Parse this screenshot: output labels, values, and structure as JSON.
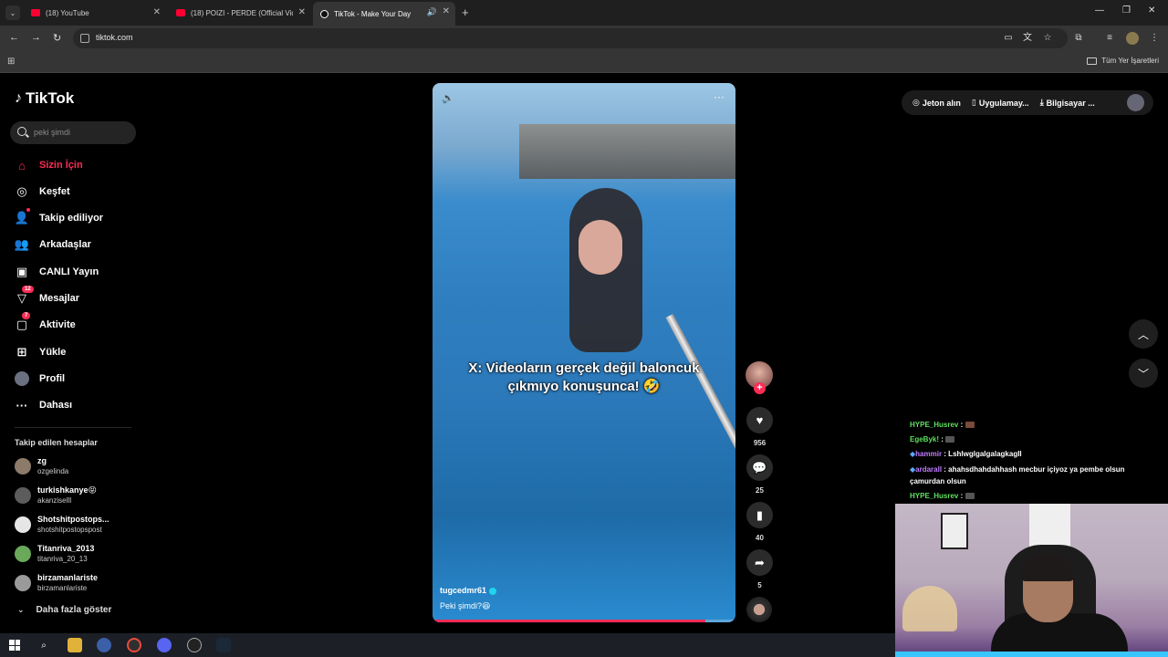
{
  "browser": {
    "tabs": [
      {
        "title": "(18) YouTube"
      },
      {
        "title": "(18) POIZI - PERDE (Official Vid"
      },
      {
        "title": "TikTok - Make Your Day"
      }
    ],
    "url": "tiktok.com",
    "bookmarks_label": "Tüm Yer İşaretleri"
  },
  "sidebar": {
    "logo": "TikTok",
    "search_placeholder": "peki şimdi",
    "nav": [
      {
        "label": "Sizin İçin",
        "icon": "home-icon"
      },
      {
        "label": "Keşfet",
        "icon": "compass-icon"
      },
      {
        "label": "Takip ediliyor",
        "icon": "following-icon"
      },
      {
        "label": "Arkadaşlar",
        "icon": "friends-icon"
      },
      {
        "label": "CANLI Yayın",
        "icon": "live-icon"
      },
      {
        "label": "Mesajlar",
        "icon": "messages-icon",
        "badge": "12"
      },
      {
        "label": "Aktivite",
        "icon": "activity-icon",
        "badge": "7"
      },
      {
        "label": "Yükle",
        "icon": "upload-icon"
      },
      {
        "label": "Profil",
        "icon": "profile-icon"
      },
      {
        "label": "Dahası",
        "icon": "more-icon"
      }
    ],
    "following_title": "Takip edilen hesaplar",
    "following": [
      {
        "name": "zg",
        "username": "ozgelinda"
      },
      {
        "name": "turkishkanye😝",
        "username": "akanzisellI"
      },
      {
        "name": "Shotshitpostops...",
        "username": "shotshitpostopspost"
      },
      {
        "name": "Titanriva_2013",
        "username": "titanriva_20_13"
      },
      {
        "name": "birzamanlariste",
        "username": "birzamanlariste"
      }
    ],
    "show_more": "Daha fazla göster"
  },
  "video": {
    "caption_line1": "X: Videoların gerçek değil baloncuk",
    "caption_line2": "çıkmıyo konuşunca! 🤣",
    "author": "tugcedmr61",
    "description": "Peki şimdi?😆",
    "progress": 0.9
  },
  "actions": {
    "likes": "956",
    "comments": "25",
    "saves": "40",
    "shares": "5"
  },
  "topbar": {
    "coins": "Jeton alın",
    "app": "Uygulamay...",
    "desktop": "Bilgisayar ..."
  },
  "chat": [
    {
      "user": "HYPE_Husrev",
      "text": ":",
      "color": "green"
    },
    {
      "user": "EgeByk!",
      "text": ":",
      "color": "green"
    },
    {
      "user": "hammir",
      "text": ": LshlwglgalgalagkagII",
      "color": "purple"
    },
    {
      "user": "ardarall",
      "text": ": ahahsdhahdahhash mecbur içiyoz ya pembe olsun çamurdan olsun",
      "color": "purple"
    },
    {
      "user": "HYPE_Husrev",
      "text": ":",
      "color": "green"
    }
  ]
}
